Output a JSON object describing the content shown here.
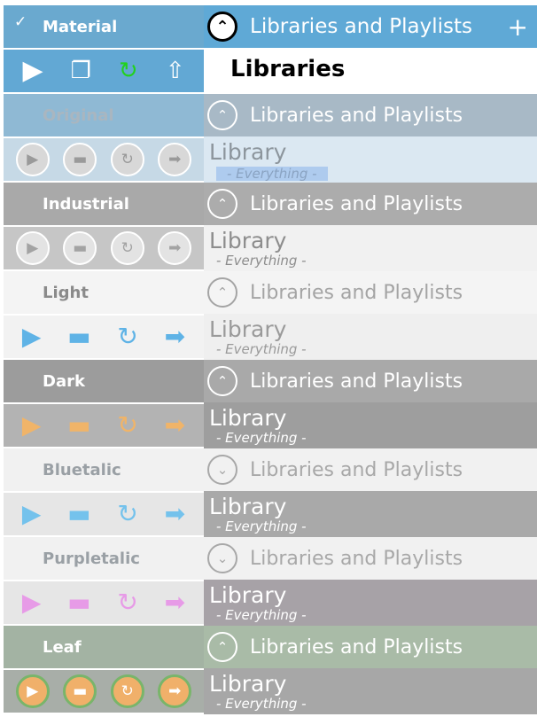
{
  "themes": [
    {
      "name": "Material",
      "checked": true,
      "header_bg": "#6aa9cf",
      "header_color": "#ffffff",
      "row_bg": "#62a8d4",
      "icon_style": "flat",
      "icons": [
        "play-icon",
        "window-icon",
        "refresh-icon",
        "share-icon"
      ]
    },
    {
      "name": "Original",
      "header_bg": "#8fb9d4",
      "header_color": "#a9b6c0",
      "row_bg": "#c6d9e6",
      "orb_bg": "#d8d8d8",
      "orb_fg": "#9a9a9a",
      "icon_style": "orb",
      "icons": [
        "play-icon",
        "monitor-icon",
        "refresh-icon",
        "arrow-right-icon"
      ]
    },
    {
      "name": "Industrial",
      "header_bg": "#a9a9a9",
      "header_color": "#ffffff",
      "row_bg": "#c6c6c6",
      "orb_bg": "#e3e3e3",
      "orb_fg": "#a3a3a3",
      "icon_style": "orb",
      "icons": [
        "play-icon",
        "monitor-icon",
        "refresh-icon",
        "arrow-right-icon"
      ]
    },
    {
      "name": "Light",
      "header_bg": "#f4f4f4",
      "header_color": "#8a8a8a",
      "row_bg": "#f2f2f2",
      "orb_bg": "transparent",
      "orb_fg": "#5fb3e6",
      "icon_style": "glyph",
      "icons": [
        "play-icon",
        "monitor-icon",
        "refresh-icon",
        "arrow-right-icon"
      ]
    },
    {
      "name": "Dark",
      "header_bg": "#9c9c9c",
      "header_color": "#ffffff",
      "row_bg": "#b3b3b3",
      "orb_bg": "transparent",
      "orb_fg": "#f0b469",
      "icon_style": "glyph",
      "icons": [
        "play-icon",
        "monitor-icon",
        "refresh-icon",
        "arrow-right-icon"
      ]
    },
    {
      "name": "Bluetalic",
      "header_bg": "#f1f1f1",
      "header_color": "#9aa0a5",
      "row_bg": "#e6e6e6",
      "orb_bg": "transparent",
      "orb_fg": "#74c2ec",
      "icon_style": "glyph",
      "icons": [
        "play-icon",
        "monitor-icon",
        "refresh-icon",
        "arrow-right-icon"
      ]
    },
    {
      "name": "Purpletalic",
      "header_bg": "#f1f1f1",
      "header_color": "#9aa0a5",
      "row_bg": "#e6e6e6",
      "orb_bg": "transparent",
      "orb_fg": "#e79be7",
      "icon_style": "glyph",
      "icons": [
        "play-icon",
        "monitor-icon",
        "refresh-icon",
        "arrow-right-icon"
      ]
    },
    {
      "name": "Leaf",
      "header_bg": "#a3b3a3",
      "header_color": "#ffffff",
      "row_bg": "#a8aea8",
      "orb_bg": "#f0b06a",
      "orb_fg": "#ffffff",
      "orb_ring": "#79b56a",
      "icon_style": "orb",
      "icons": [
        "play-icon",
        "monitor-icon",
        "refresh-icon",
        "arrow-right-icon"
      ]
    }
  ],
  "panels": [
    {
      "header": "Libraries and Playlists",
      "chevron": "up",
      "header_bg": "#5fa9d6",
      "header_color": "#ffffff",
      "circle_bg": "#ffffff",
      "circle_fg": "#000000",
      "show_plus": true,
      "title": "Libraries",
      "subtitle": "",
      "row_bg": "#ffffff",
      "title_color": "#000000",
      "sub_color": "#9aa0a5",
      "bold_title": true
    },
    {
      "header": "Libraries and Playlists",
      "chevron": "up",
      "header_bg": "#a8b9c6",
      "header_color": "#ffffff",
      "circle_bg": "transparent",
      "circle_fg": "#ffffff",
      "title": "Library",
      "subtitle": "- Everything -",
      "row_bg": "#dbe8f2",
      "title_color": "#8c959c",
      "sub_color": "#8aa3c2",
      "sub_bg": "#aecbee"
    },
    {
      "header": "Libraries and Playlists",
      "chevron": "up",
      "header_bg": "#acacac",
      "header_color": "#ffffff",
      "circle_bg": "transparent",
      "circle_fg": "#ffffff",
      "title": "Library",
      "subtitle": "- Everything -",
      "row_bg": "#f1f1f1",
      "title_color": "#8d8d8d",
      "sub_color": "#8d8d8d"
    },
    {
      "header": "Libraries and Playlists",
      "chevron": "up",
      "header_bg": "#f4f4f4",
      "header_color": "#a4a4a4",
      "circle_bg": "transparent",
      "circle_fg": "#a4a4a4",
      "title": "Library",
      "subtitle": "- Everything -",
      "row_bg": "#efefef",
      "title_color": "#9a9a9a",
      "sub_color": "#9a9a9a"
    },
    {
      "header": "Libraries and Playlists",
      "chevron": "up",
      "header_bg": "#a9a9a9",
      "header_color": "#ffffff",
      "circle_bg": "transparent",
      "circle_fg": "#ffffff",
      "title": "Library",
      "subtitle": "- Everything -",
      "row_bg": "#9e9e9e",
      "title_color": "#ffffff",
      "sub_color": "#ffffff"
    },
    {
      "header": "Libraries and Playlists",
      "chevron": "down",
      "header_bg": "#f1f1f1",
      "header_color": "#a8a8a8",
      "circle_bg": "transparent",
      "circle_fg": "#a8a8a8",
      "title": "Library",
      "subtitle": "- Everything -",
      "row_bg": "#a9a9a9",
      "title_color": "#ffffff",
      "sub_color": "#ffffff"
    },
    {
      "header": "Libraries and Playlists",
      "chevron": "down",
      "header_bg": "#f1f1f1",
      "header_color": "#a8a8a8",
      "circle_bg": "transparent",
      "circle_fg": "#a8a8a8",
      "title": "Library",
      "subtitle": "- Everything -",
      "row_bg": "#a7a2a7",
      "title_color": "#ffffff",
      "sub_color": "#ffffff"
    },
    {
      "header": "Libraries and Playlists",
      "chevron": "up",
      "header_bg": "#a9bba7",
      "header_color": "#ffffff",
      "circle_bg": "transparent",
      "circle_fg": "#ffffff",
      "title": "Library",
      "subtitle": "- Everything -",
      "row_bg": "#a7a7a7",
      "title_color": "#ffffff",
      "sub_color": "#ffffff"
    }
  ],
  "add_button": "+",
  "check_mark": "✓"
}
